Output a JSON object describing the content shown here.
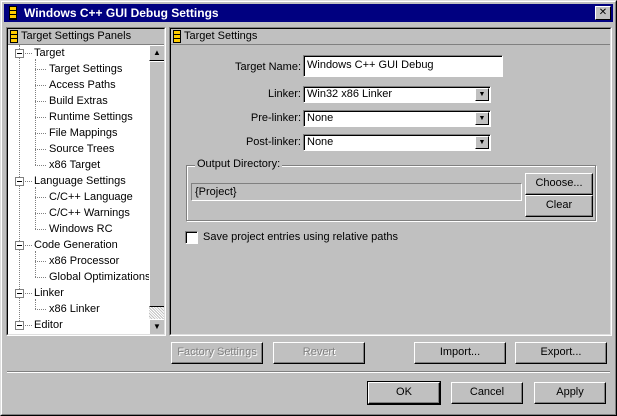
{
  "window": {
    "title": "Windows C++ GUI Debug Settings",
    "close_glyph": "✕"
  },
  "tree_panel": {
    "header": "Target Settings Panels",
    "items": [
      {
        "label": "Target",
        "level": 0
      },
      {
        "label": "Target Settings",
        "level": 1
      },
      {
        "label": "Access Paths",
        "level": 1
      },
      {
        "label": "Build Extras",
        "level": 1
      },
      {
        "label": "Runtime Settings",
        "level": 1
      },
      {
        "label": "File Mappings",
        "level": 1
      },
      {
        "label": "Source Trees",
        "level": 1
      },
      {
        "label": "x86 Target",
        "level": 1
      },
      {
        "label": "Language Settings",
        "level": 0
      },
      {
        "label": "C/C++ Language",
        "level": 1
      },
      {
        "label": "C/C++ Warnings",
        "level": 1
      },
      {
        "label": "Windows RC",
        "level": 1
      },
      {
        "label": "Code Generation",
        "level": 0
      },
      {
        "label": "x86 Processor",
        "level": 1
      },
      {
        "label": "Global Optimizations",
        "level": 1
      },
      {
        "label": "Linker",
        "level": 0
      },
      {
        "label": "x86 Linker",
        "level": 1
      },
      {
        "label": "Editor",
        "level": 0
      }
    ]
  },
  "settings_panel": {
    "header": "Target Settings",
    "target_name_label": "Target Name:",
    "target_name_value": "Windows C++ GUI Debug",
    "linker_label": "Linker:",
    "linker_value": "Win32 x86 Linker",
    "prelinker_label": "Pre-linker:",
    "prelinker_value": "None",
    "postlinker_label": "Post-linker:",
    "postlinker_value": "None",
    "output_dir_label": "Output Directory:",
    "output_dir_value": "{Project}",
    "choose_label": "Choose...",
    "clear_label": "Clear",
    "relative_paths_label": "Save project entries using relative paths",
    "relative_paths_checked": false
  },
  "panel_buttons": {
    "factory_settings": "Factory Settings",
    "revert": "Revert",
    "import": "Import...",
    "export": "Export..."
  },
  "dialog_buttons": {
    "ok": "OK",
    "cancel": "Cancel",
    "apply": "Apply"
  },
  "colors": {
    "titlebar": "#000080",
    "face": "#c0c0c0",
    "window": "#ffffff",
    "shadow": "#808080"
  }
}
